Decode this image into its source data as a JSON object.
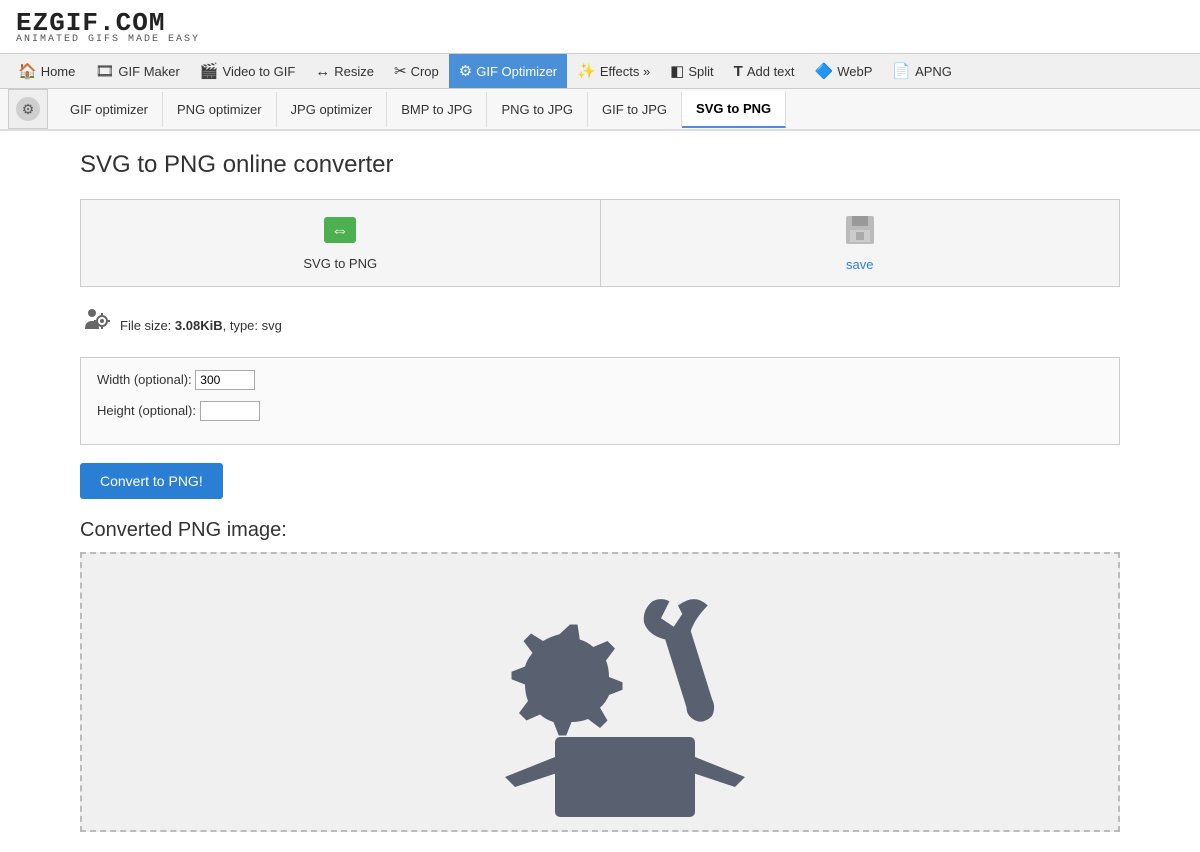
{
  "logo": {
    "main": "EZGIF.COM",
    "sub": "ANIMATED GIFS MADE EASY"
  },
  "navbar": {
    "items": [
      {
        "id": "home",
        "icon": "🏠",
        "label": "Home"
      },
      {
        "id": "gif-maker",
        "icon": "🎞",
        "label": "GIF Maker"
      },
      {
        "id": "video-to-gif",
        "icon": "🎬",
        "label": "Video to GIF"
      },
      {
        "id": "resize",
        "icon": "↔",
        "label": "Resize"
      },
      {
        "id": "crop",
        "icon": "✂",
        "label": "Crop"
      },
      {
        "id": "gif-optimizer",
        "icon": "⚙",
        "label": "GIF Optimizer",
        "active": true
      },
      {
        "id": "effects",
        "icon": "✨",
        "label": "Effects »"
      },
      {
        "id": "split",
        "icon": "◧",
        "label": "Split"
      },
      {
        "id": "add-text",
        "icon": "T",
        "label": "Add text"
      },
      {
        "id": "webp",
        "icon": "🔷",
        "label": "WebP"
      },
      {
        "id": "apng",
        "icon": "📄",
        "label": "APNG"
      }
    ]
  },
  "subnav": {
    "items": [
      {
        "id": "gif-optimizer",
        "label": "GIF optimizer"
      },
      {
        "id": "png-optimizer",
        "label": "PNG optimizer"
      },
      {
        "id": "jpg-optimizer",
        "label": "JPG optimizer"
      },
      {
        "id": "bmp-to-jpg",
        "label": "BMP to JPG"
      },
      {
        "id": "png-to-jpg",
        "label": "PNG to JPG"
      },
      {
        "id": "gif-to-jpg",
        "label": "GIF to JPG"
      },
      {
        "id": "svg-to-png",
        "label": "SVG to PNG",
        "active": true
      }
    ]
  },
  "page": {
    "title": "SVG to PNG online converter",
    "action_buttons": [
      {
        "id": "svg-to-png-btn",
        "icon": "↔",
        "label": "SVG to PNG",
        "color": "green"
      },
      {
        "id": "save-btn",
        "icon": "💾",
        "label": "save",
        "color": "blue"
      }
    ],
    "file_info": {
      "size": "3.08KiB",
      "type": "svg",
      "prefix": "File size: ",
      "suffix": ", type: svg"
    },
    "options": {
      "width_label": "Width (optional):",
      "width_value": "300",
      "height_label": "Height (optional):",
      "height_value": ""
    },
    "convert_button": "Convert to PNG!",
    "converted_section_title": "Converted PNG image:"
  }
}
